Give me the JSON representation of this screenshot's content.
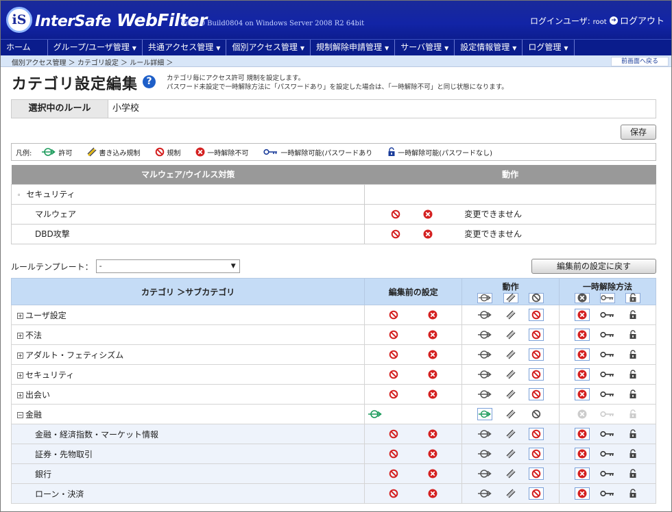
{
  "header": {
    "logo_letters": "iS",
    "logo_text_a": "Inter",
    "logo_text_b": "Safe",
    "logo_text_c": " WebFilter",
    "version": "Ver.8.0 Build0804 on Windows Server 2008 R2 64bit",
    "login_label": "ログインユーザ:",
    "login_user": "root",
    "logout": "ログアウト"
  },
  "menu": [
    "ホーム",
    "グループ/ユーザ管理",
    "共通アクセス管理",
    "個別アクセス管理",
    "規制解除申請管理",
    "サーバ管理",
    "設定情報管理",
    "ログ管理"
  ],
  "breadcrumb": "個別アクセス管理 ＞ カテゴリ設定 ＞ ルール詳細 ＞",
  "back_link": "前画面へ戻る",
  "title": "カテゴリ設定編集",
  "description": [
    "カテゴリ毎にアクセス許可 規制を設定します。",
    "パスワード未設定で一時解除方法に「パスワードあり」を設定した場合は、「一時解除不可」と同じ状態になります。"
  ],
  "rule": {
    "label": "選択中のルール",
    "value": "小学校"
  },
  "save_button": "保存",
  "legend": {
    "label": "凡例:",
    "items": [
      {
        "icon": "allow-icon",
        "text": "許可"
      },
      {
        "icon": "write-restrict-icon",
        "text": "書き込み規制"
      },
      {
        "icon": "block-icon",
        "text": "規制"
      },
      {
        "icon": "no-unlock-icon",
        "text": "一時解除不可"
      },
      {
        "icon": "key-icon",
        "text": "一時解除可能(パスワードあり"
      },
      {
        "icon": "lock-icon",
        "text": "一時解除可能(パスワードなし)"
      }
    ]
  },
  "malware": {
    "col1": "マルウェア/ウイルス対策",
    "col2": "動作",
    "section": "セキュリティ",
    "rows": [
      {
        "name": "マルウェア",
        "status": "変更できません"
      },
      {
        "name": "DBD攻撃",
        "status": "変更できません"
      }
    ]
  },
  "template": {
    "label": "ルールテンプレート：",
    "value": "-"
  },
  "revert_button": "編集前の設定に戻す",
  "category": {
    "col_category": "カテゴリ ＞サブカテゴリ",
    "col_before": "編集前の設定",
    "col_action": "動作",
    "col_unlock": "一時解除方法",
    "rows": [
      {
        "name": "ユーザ設定",
        "type": "parent",
        "expander": "+",
        "state": "block"
      },
      {
        "name": "不法",
        "type": "parent",
        "expander": "+",
        "state": "block"
      },
      {
        "name": "アダルト・フェティシズム",
        "type": "parent",
        "expander": "+",
        "state": "block"
      },
      {
        "name": "セキュリティ",
        "type": "parent",
        "expander": "+",
        "state": "block"
      },
      {
        "name": "出会い",
        "type": "parent",
        "expander": "+",
        "state": "block"
      },
      {
        "name": "金融",
        "type": "parent",
        "expander": "−",
        "state": "allow"
      },
      {
        "name": "金融・経済指数・マーケット情報",
        "type": "sub",
        "state": "block"
      },
      {
        "name": "証券・先物取引",
        "type": "sub",
        "state": "block"
      },
      {
        "name": "銀行",
        "type": "sub",
        "state": "block"
      },
      {
        "name": "ローン・決済",
        "type": "sub",
        "state": "block"
      }
    ]
  },
  "colors": {
    "brand": "#1224a6",
    "menu": "#0a1c8c",
    "header_cell": "#c5dcf6",
    "block_red": "#d42020",
    "allow_green": "#1a9a5a"
  }
}
